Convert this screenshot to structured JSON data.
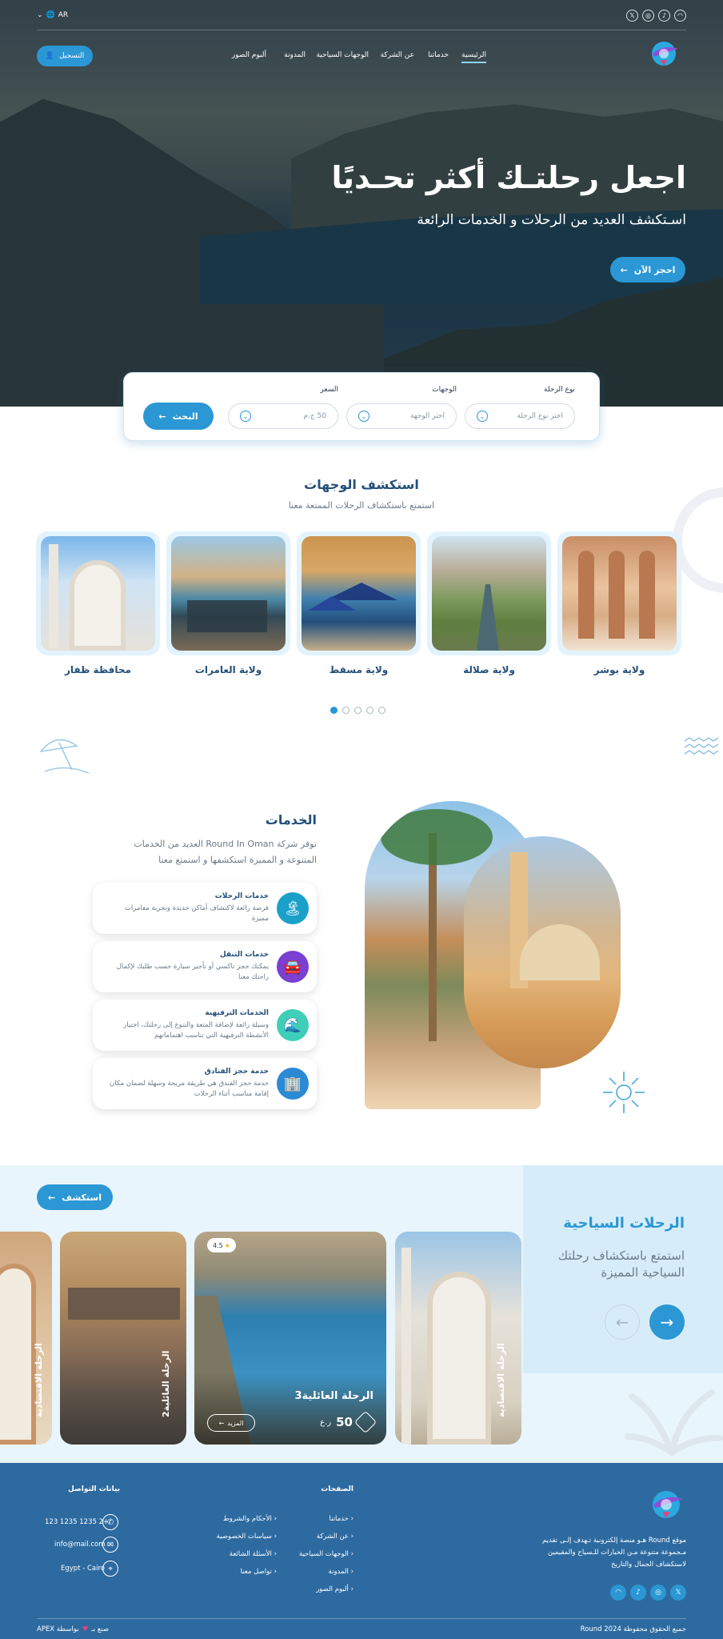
{
  "header": {
    "lang": "AR",
    "register": "التسجيل",
    "nav": [
      "الرئيسية",
      "خدماتنا",
      "عن الشركة",
      "الوجهات السياحية",
      "المدونة",
      "ألبوم الصور"
    ],
    "social": [
      "x-icon",
      "instagram-icon",
      "tiktok-icon",
      "snapchat-icon"
    ]
  },
  "hero": {
    "title": "اجعل رحلتـك أكثر تحـديًا",
    "subtitle": "اسـتكشف العديد من الرحلات و الخدمات الرائعة",
    "cta": "احجز الآن"
  },
  "search": {
    "trip_type_label": "نوع الرحلة",
    "trip_type_placeholder": "اختر نوع الرحلة",
    "dest_label": "الوجهات",
    "dest_placeholder": "اختر الوجهة",
    "price_label": "السعر",
    "price_value": "50 ج.م",
    "button": "البحث"
  },
  "destinations": {
    "title": "استكشف الوجهات",
    "subtitle": "استمتع باستكشاف الرحلات الممتعة معنا",
    "items": [
      "ولاية بوشر",
      "ولاية صلالة",
      "ولاية مسقط",
      "ولاية العامرات",
      "محافظة ظفار"
    ],
    "dots": 5,
    "active_dot": 0
  },
  "services": {
    "title": "الخدمات",
    "intro_line1": "توفر شركة Round In Oman العديد من الخدمات",
    "intro_line2": "المتنوعة و المميزة استكشفها و استمتع معنا",
    "items": [
      {
        "title": "خدمات الرحلات",
        "desc": "فرصة رائعة لاكتشاف أماكن جديدة وتجربة مغامرات مميزة",
        "icon": "island-icon",
        "color": "#1aa0c9"
      },
      {
        "title": "خدمات التنقل",
        "desc": "يمكنك حجز تاكسي أو تأجير سيارة حسب طلبك لإكمال راحتك معنا",
        "icon": "car-icon",
        "color": "#7b3fd1"
      },
      {
        "title": "الخدمات الترفيهية",
        "desc": "وسيلة رائعة لإضافة المتعة والتنوع إلى رحلتك، اختيار الأنشطة الترفيهية التي تناسب اهتماماتهم",
        "icon": "water-slide-icon",
        "color": "#3fcfb8"
      },
      {
        "title": "خدمة حجز الفنادق",
        "desc": "خدمة حجز الفندق هي طريقة مريحة وسهلة لضمان مكان إقامة مناسب أثناء الرحلات",
        "icon": "hotel-icon",
        "color": "#2b8ad4"
      }
    ]
  },
  "trips": {
    "title": "الرحلات السياحية",
    "subtitle_line1": "استمتع باستكشاف رحلتك",
    "subtitle_line2": "السياحية المميزة",
    "explore": "استكشف",
    "featured": {
      "name": "الرحلة العائلية3",
      "price": "50",
      "currency": "ر.ع",
      "rating": "4.5",
      "more": "المزيد"
    },
    "cards": [
      "الرحلة الاقتصادية",
      "الرحلة العائلية2",
      "الرحلة الاقتصادية"
    ]
  },
  "footer": {
    "about_brand": "Round",
    "about_line1": "موقع  Round  هـو منصة إلكترونية تـهدف إلـى تقديم",
    "about_line2": "مـجموعة متنوعة مـن الخيارات للـسياح والمقيمين",
    "about_line3": "لاستكشاف الجمال والتاريخ",
    "pages_title": "الصفحات",
    "pages": [
      "خدماتنا",
      "عن الشركة",
      "الوجهات السياحية",
      "المدونة",
      "ألبوم الصور"
    ],
    "links": [
      "الأحكام والشروط",
      "سياسات الخصوصية",
      "الأسئلة الشائعة",
      "تواصل معنا"
    ],
    "contact_title": "بيانات التواصل",
    "phone": "123 1235 1235 2+",
    "email": "info@mail.com",
    "address": "Egypt - Cairo",
    "copyright": "جميع الحقوق محفوظة  Round  2024",
    "made_by": "صنع بـ",
    "made_by2": "بواسطة APEX"
  }
}
